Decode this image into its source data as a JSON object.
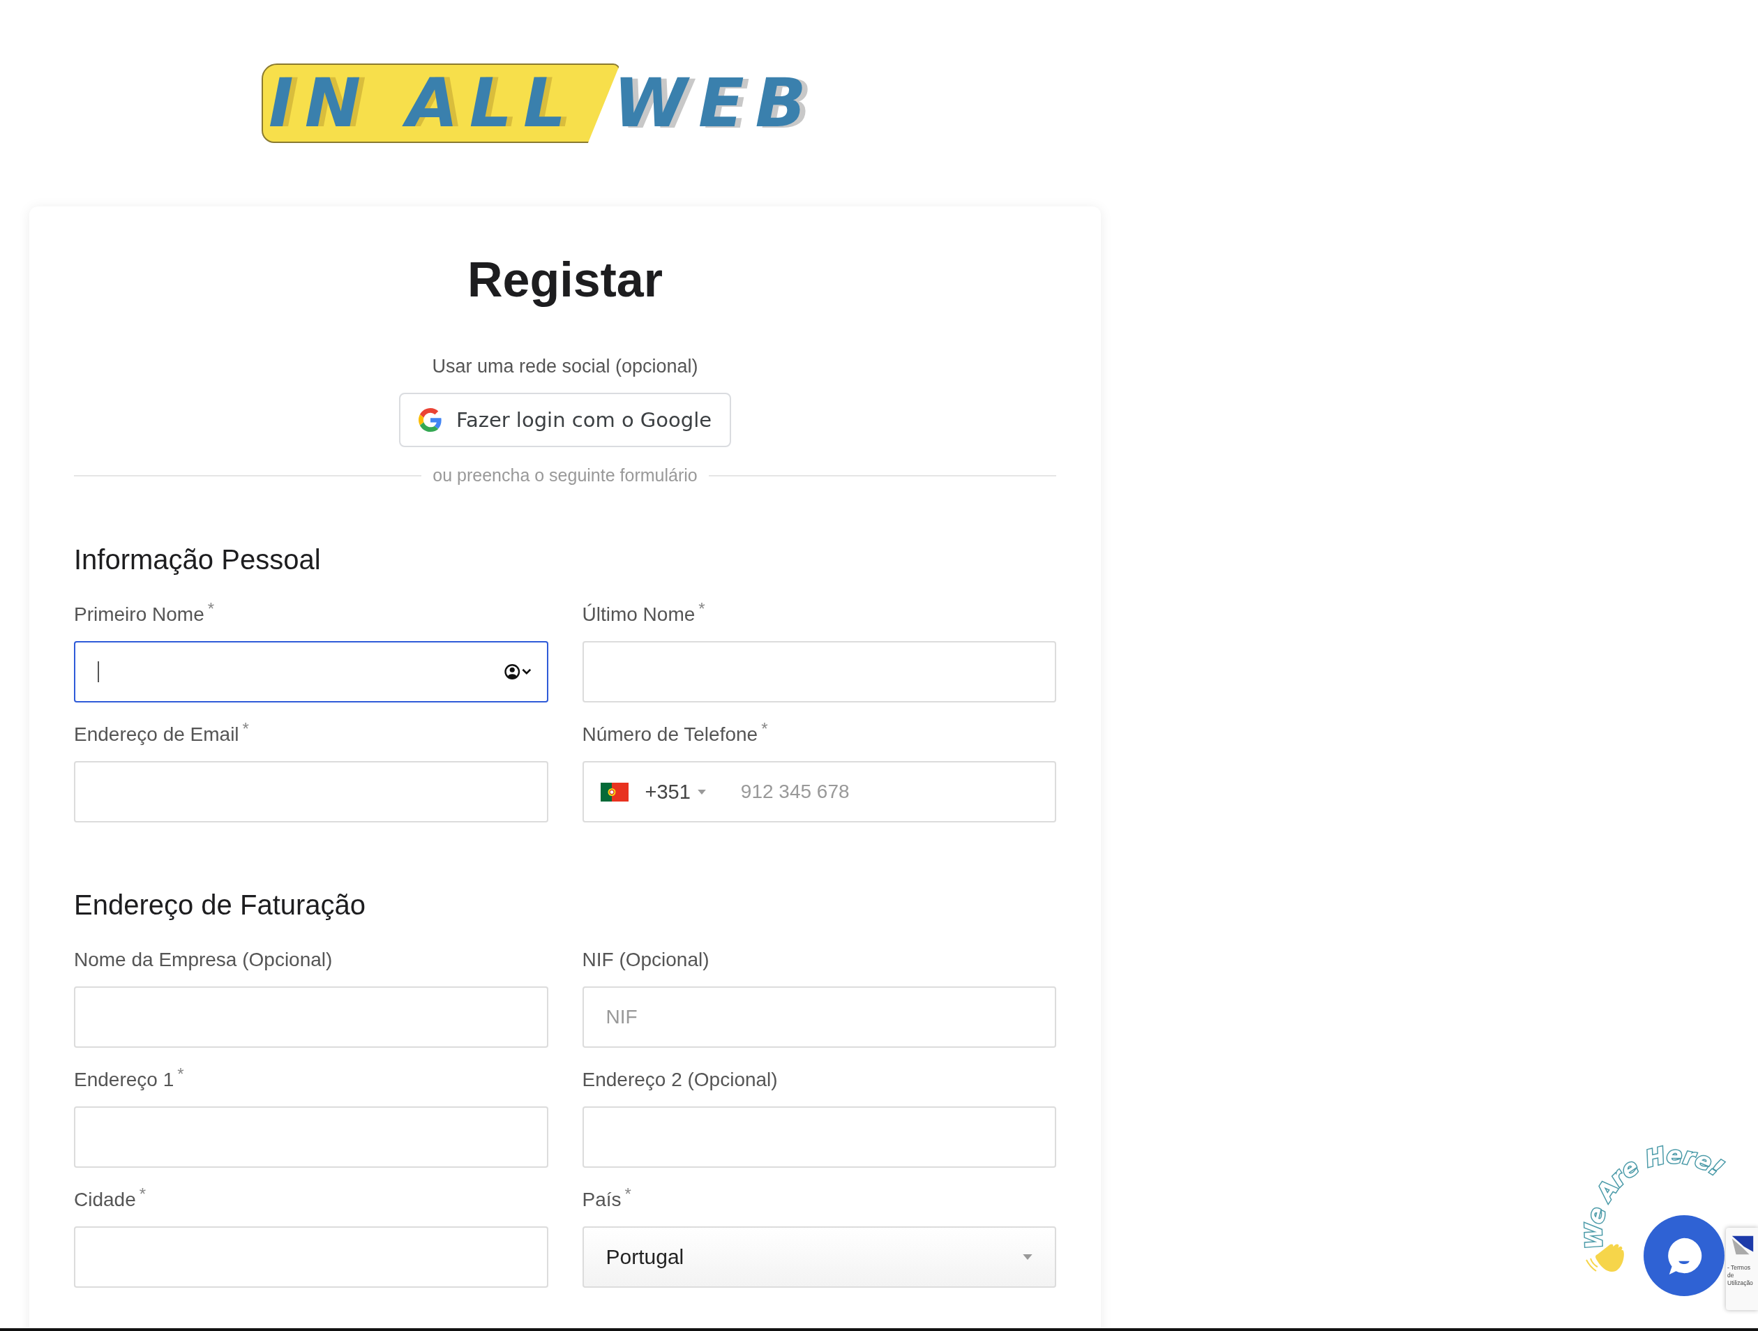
{
  "logo": {
    "left": "IN ALL",
    "right": "WEB"
  },
  "title": "Registar",
  "social": {
    "label": "Usar uma rede social (opcional)",
    "google_button": "Fazer login com o Google"
  },
  "divider": "ou preencha o seguinte formulário",
  "sections": [
    {
      "title": "Informação Pessoal",
      "fields": [
        {
          "kind": "text",
          "label": "Primeiro Nome",
          "required_mark": "*",
          "focused": true,
          "autofill": true
        },
        {
          "kind": "text",
          "label": "Último Nome",
          "required_mark": "*",
          "focused": false
        },
        {
          "kind": "text",
          "label": "Endereço de Email",
          "required_mark": "*",
          "focused": false
        },
        {
          "kind": "phone",
          "label": "Número de Telefone",
          "required_mark": "*",
          "focused": false,
          "country_code": "+351",
          "placeholder": "912 345 678"
        }
      ]
    },
    {
      "title": "Endereço de Faturação",
      "fields": [
        {
          "kind": "text",
          "label": "Nome da Empresa (Opcional)",
          "focused": false
        },
        {
          "kind": "text",
          "label": "NIF (Opcional)",
          "focused": false,
          "placeholder": "NIF"
        },
        {
          "kind": "text",
          "label": "Endereço 1",
          "required_mark": "*",
          "focused": false
        },
        {
          "kind": "text",
          "label": "Endereço 2 (Opcional)",
          "focused": false
        },
        {
          "kind": "text",
          "label": "Cidade",
          "required_mark": "*",
          "focused": false
        },
        {
          "kind": "select",
          "label": "País",
          "required_mark": "*",
          "focused": false,
          "value": "Portugal"
        }
      ]
    }
  ],
  "chat": {
    "bubble_text": "We Are Here!"
  },
  "recaptcha": {
    "text": "- Termos de Utilização"
  }
}
